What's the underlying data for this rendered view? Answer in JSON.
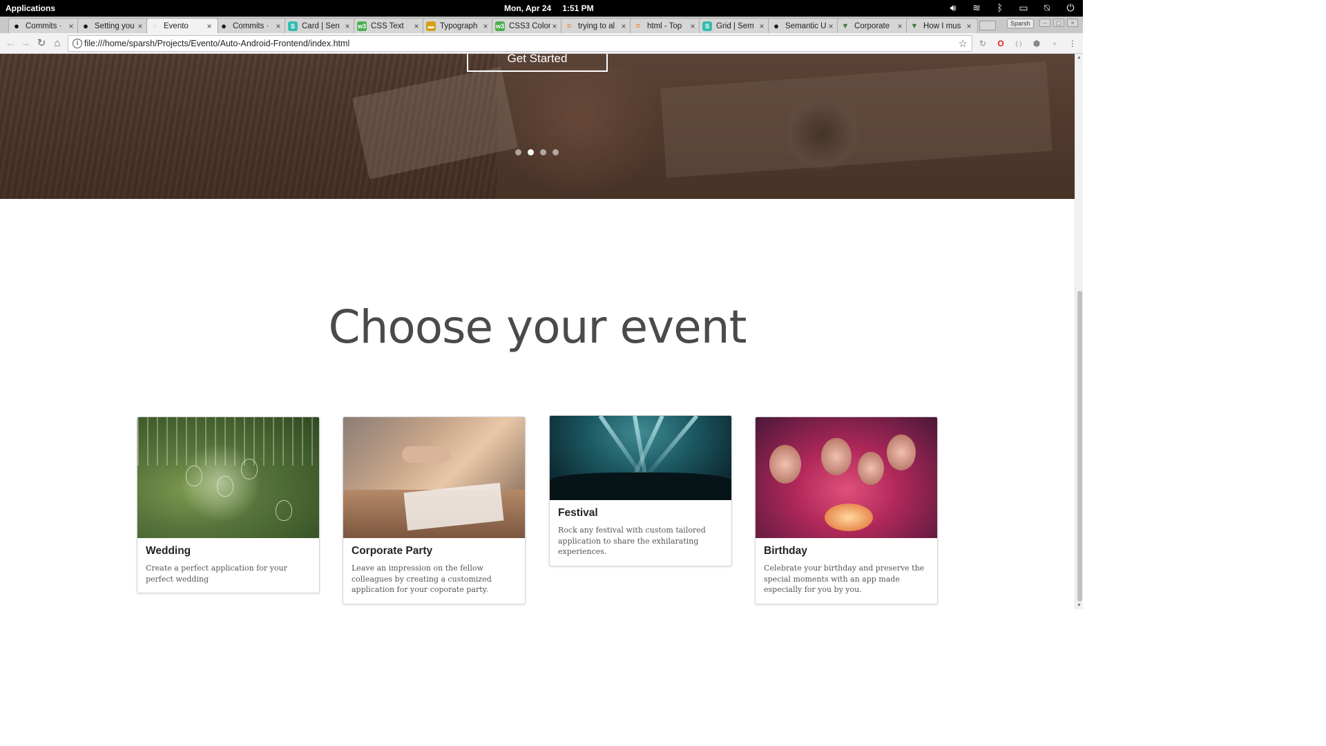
{
  "system_bar": {
    "apps_label": "Applications",
    "date": "Mon, Apr 24",
    "time": "1:51 PM"
  },
  "tabs": [
    {
      "title": "Commits ·",
      "favicon": "github-icon"
    },
    {
      "title": "Setting you",
      "favicon": "github-icon"
    },
    {
      "title": "Evento",
      "favicon": "page-icon",
      "active": true
    },
    {
      "title": "Commits ·",
      "favicon": "github-icon"
    },
    {
      "title": "Card | Sen",
      "favicon": "semantic-icon"
    },
    {
      "title": "CSS Text",
      "favicon": "w3schools-icon"
    },
    {
      "title": "Typograph",
      "favicon": "flag-icon"
    },
    {
      "title": "CSS3 Color",
      "favicon": "w3schools-icon"
    },
    {
      "title": "trying to al",
      "favicon": "stackoverflow-icon"
    },
    {
      "title": "html - Top",
      "favicon": "stackoverflow-icon"
    },
    {
      "title": "Grid | Sem",
      "favicon": "semantic-icon"
    },
    {
      "title": "Semantic U",
      "favicon": "github-icon"
    },
    {
      "title": "Corporate",
      "favicon": "funnel-icon"
    },
    {
      "title": "How I mus",
      "favicon": "funnel-icon"
    }
  ],
  "profile_label": "Sparsh",
  "address_bar": {
    "url": "file:///home/sparsh/Projects/Evento/Auto-Android-Frontend/index.html"
  },
  "hero": {
    "cta_label": "Get Started",
    "slide_count": 4,
    "active_slide": 2
  },
  "section": {
    "title": "Choose your event"
  },
  "cards": [
    {
      "title": "Wedding",
      "description": "Create a perfect application for your perfect wedding"
    },
    {
      "title": "Corporate Party",
      "description": "Leave an impression on the fellow colleagues by creating a customized application for your coporate party."
    },
    {
      "title": "Festival",
      "description": "Rock any festival with custom tailored application to share the exhilarating experiences."
    },
    {
      "title": "Birthday",
      "description": "Celebrate your birthday and preserve the special moments with an app made especially for you by you."
    }
  ],
  "colors": {
    "system_bar": "#000000",
    "tab_strip": "#c8c8c8",
    "title_text": "#4a4a4a"
  }
}
